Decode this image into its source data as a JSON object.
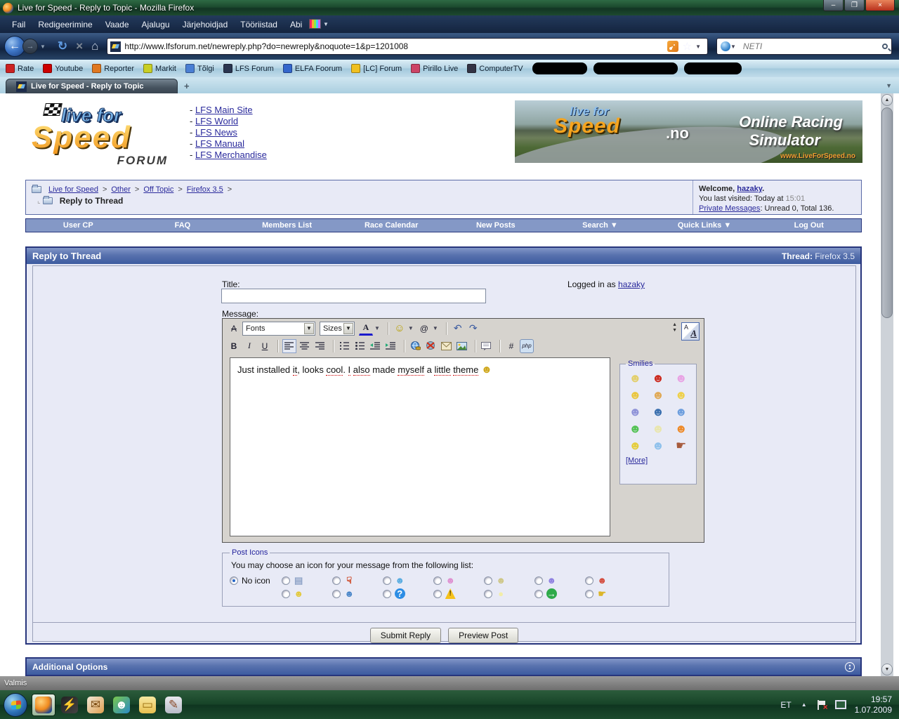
{
  "chrome": {
    "title": "Live for Speed - Reply to Topic - Mozilla Firefox",
    "win": {
      "min": "–",
      "max": "❐",
      "close": "×"
    },
    "menu": [
      "Fail",
      "Redigeerimine",
      "Vaade",
      "Ajalugu",
      "Järjehoidjad",
      "Tööriistad",
      "Abi"
    ],
    "dropdown_glyph": "▼",
    "back_glyph": "←",
    "forward_glyph": "→",
    "reload_glyph": "↻",
    "stop_glyph": "×",
    "home_glyph": "⌂",
    "star_glyph": "☆",
    "url": "http://www.lfsforum.net/newreply.php?do=newreply&noquote=1&p=1201008",
    "search_placeholder": "NETI",
    "bookmarks": [
      {
        "label": "Rate",
        "color": "#cc2222"
      },
      {
        "label": "Youtube",
        "color": "#cc0000"
      },
      {
        "label": "Reporter",
        "color": "#e07820"
      },
      {
        "label": "Markit",
        "color": "#c9cf25"
      },
      {
        "label": "Tõlgi",
        "color": "#4a7fd4"
      },
      {
        "label": "LFS Forum",
        "color": "#2a3550"
      },
      {
        "label": "ELFA Foorum",
        "color": "#3366cc"
      },
      {
        "label": "[LC] Forum",
        "color": "#f0c020"
      },
      {
        "label": "Pirillo Live",
        "color": "#cc4466"
      },
      {
        "label": "ComputerTV",
        "color": "#333344"
      }
    ],
    "tab_title": "Live for Speed - Reply to Topic",
    "new_tab": "+",
    "scroll_up": "▲",
    "scroll_down": "▼"
  },
  "header": {
    "logo": {
      "top": "live for",
      "main": "Speed",
      "sub": "FORUM"
    },
    "links": [
      "LFS Main Site",
      "LFS World",
      "LFS News",
      "LFS Manual",
      "LFS Merchandise"
    ],
    "banner": {
      "logo_top": "live for",
      "logo_main": "Speed",
      "tld": ".no",
      "line1": "Online Racing",
      "line2": "Simulator",
      "site": "www.LiveForSpeed.no"
    }
  },
  "breadcrumb": {
    "links": [
      "Live for Speed",
      "Other",
      "Off Topic",
      "Firefox 3.5"
    ],
    "sep": ">",
    "current": "Reply to Thread"
  },
  "welcome": {
    "greeting": "Welcome,",
    "username": "hazaky",
    "dot": ".",
    "visited_prefix": "You last visited: Today at",
    "visited_time": "15:01",
    "pm_link": "Private Messages",
    "pm_rest": ": Unread 0, Total 136."
  },
  "forum_nav": [
    "User CP",
    "FAQ",
    "Members List",
    "Race Calendar",
    "New Posts",
    "Search ▼",
    "Quick Links ▼",
    "Log Out"
  ],
  "reply": {
    "header": "Reply to Thread",
    "thread_label": "Thread:",
    "thread_value": "Firefox 3.5",
    "title_label": "Title:",
    "logged_prefix": "Logged in as",
    "logged_user": "hazaky",
    "message_label": "Message:"
  },
  "editor": {
    "fonts": "Fonts",
    "sizes": "Sizes",
    "toolbar": {
      "remove_format": "A",
      "color": "A",
      "smiley": "☺",
      "attach": "@",
      "undo": "↶",
      "redo": "↷",
      "bold": "B",
      "italic": "I",
      "underline": "U",
      "code": "#",
      "php": "php",
      "size_up": "▲",
      "size_down": "▼",
      "mode_small": "A",
      "mode_big": "A"
    },
    "message_segments": [
      {
        "t": "Just installed "
      },
      {
        "t": "it",
        "u": true
      },
      {
        "t": ", looks "
      },
      {
        "t": "cool",
        "u": true
      },
      {
        "t": ". "
      },
      {
        "t": "I",
        "u": true
      },
      {
        "t": " "
      },
      {
        "t": "also",
        "u": true
      },
      {
        "t": " made "
      },
      {
        "t": "myself",
        "u": true
      },
      {
        "t": " a "
      },
      {
        "t": "little",
        "u": true
      },
      {
        "t": " "
      },
      {
        "t": "theme",
        "u": true
      },
      {
        "t": " "
      }
    ],
    "end_smiley": "☻"
  },
  "smilies": {
    "legend": "Smilies",
    "items": [
      {
        "name": "smile",
        "glyph": "☻",
        "color": "#e3cf6b"
      },
      {
        "name": "mad",
        "glyph": "☻",
        "color": "#cc2a1e"
      },
      {
        "name": "tongue",
        "glyph": "☻",
        "color": "#e8a3e4"
      },
      {
        "name": "shrug",
        "glyph": "☻",
        "color": "#eac63e"
      },
      {
        "name": "cool",
        "glyph": "☻",
        "color": "#e0a955"
      },
      {
        "name": "chin",
        "glyph": "☻",
        "color": "#eed04a"
      },
      {
        "name": "uhoh",
        "glyph": "☻",
        "color": "#8f93d8"
      },
      {
        "name": "shades",
        "glyph": "☻",
        "color": "#3a6fae"
      },
      {
        "name": "thumbsup-smiley",
        "glyph": "☻",
        "color": "#6d9ede"
      },
      {
        "name": "green-smile",
        "glyph": "☻",
        "color": "#52c253"
      },
      {
        "name": "biggrin",
        "glyph": "☻",
        "color": "#e9e6ae"
      },
      {
        "name": "orange-smile",
        "glyph": "☻",
        "color": "#ee8a28"
      },
      {
        "name": "wink",
        "glyph": "☻",
        "color": "#e5cd3d"
      },
      {
        "name": "lol",
        "glyph": "☻",
        "color": "#8fc1ec"
      },
      {
        "name": "hand",
        "glyph": "☛",
        "color": "#a65a3c"
      }
    ],
    "more": "[More]"
  },
  "post_icons": {
    "legend": "Post Icons",
    "prompt": "You may choose an icon for your message from the following list:",
    "no_icon": "No icon",
    "columns": [
      {
        "top": {
          "glyph": "▤",
          "color": "#90a4c8"
        },
        "bottom": {
          "glyph": "☻",
          "color": "#e2c93e"
        }
      },
      {
        "top": {
          "glyph": "☟",
          "color": "#cc3a14"
        },
        "bottom": {
          "glyph": "☻",
          "color": "#4a86c8"
        }
      },
      {
        "top": {
          "glyph": "☻",
          "color": "#57abe0"
        },
        "bottom": {
          "glyph": "?",
          "color": "#ffffff",
          "bg": "#2d8de4"
        }
      },
      {
        "top": {
          "glyph": "☻",
          "color": "#de8fd0"
        },
        "bottom": {
          "glyph": "!",
          "color": "#553f00",
          "bg": "#f5c21d",
          "tri": true
        }
      },
      {
        "top": {
          "glyph": "☻",
          "color": "#cdc684"
        },
        "bottom": {
          "glyph": "●",
          "color": "#f2eda8"
        }
      },
      {
        "top": {
          "glyph": "☻",
          "color": "#8d7fe0"
        },
        "bottom": {
          "glyph": "→",
          "color": "#ffffff",
          "bg": "#2eaa4a"
        }
      },
      {
        "top": {
          "glyph": "☻",
          "color": "#d4493a"
        },
        "bottom": {
          "glyph": "☛",
          "color": "#dcb62a"
        }
      }
    ]
  },
  "actions": {
    "submit": "Submit Reply",
    "preview": "Preview Post"
  },
  "additional_options": {
    "label": "Additional Options",
    "collapse_glyph": "▲"
  },
  "status": {
    "text": "Valmis"
  },
  "taskbar": {
    "lang": "ET",
    "expand_glyph": "▲",
    "time": "19:57",
    "date": "1.07.2009",
    "icons": [
      {
        "name": "firefox-icon",
        "bg": "radial-gradient(circle at 35% 30%,#ffd27a,#f08a1d 50%,#2a4a8a 80%)",
        "glyph": "",
        "active": true
      },
      {
        "name": "winamp-icon",
        "bg": "linear-gradient(135deg,#222,#444)",
        "glyph": "⚡",
        "color": "#f5a020"
      },
      {
        "name": "mail-icon",
        "bg": "linear-gradient(135deg,#f0e8d8,#e0a050)",
        "glyph": "✉",
        "color": "#7a4a10"
      },
      {
        "name": "messenger-icon",
        "bg": "linear-gradient(135deg,#7ac84a,#2a8ac8)",
        "glyph": "☻",
        "color": "#fff"
      },
      {
        "name": "explorer-icon",
        "bg": "linear-gradient(180deg,#f8e8a0,#e8c050)",
        "glyph": "▭",
        "color": "#9a7010"
      },
      {
        "name": "paint-icon",
        "bg": "linear-gradient(180deg,#e8e8ee,#b8bcc8)",
        "glyph": "✎",
        "color": "#8a4a2a"
      }
    ]
  }
}
